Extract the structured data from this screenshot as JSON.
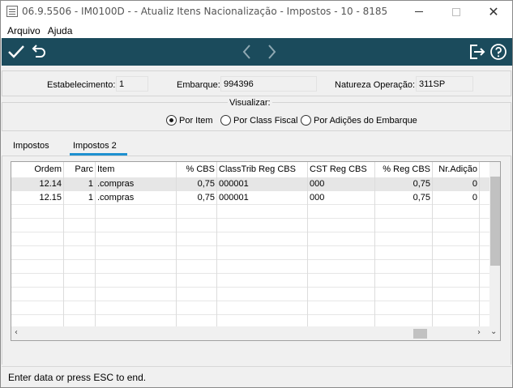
{
  "window": {
    "title": "06.9.5506 - IM0100D -  - Atualiz Itens Nacionalização - Impostos - 10 - 8185",
    "minimize_icon": "minimize-icon",
    "maximize_icon": "maximize-icon",
    "close_icon": "close-icon",
    "close_glyph": "✕"
  },
  "menu": {
    "items": [
      "Arquivo",
      "Ajuda"
    ]
  },
  "toolbar": {
    "icons": [
      "check-icon",
      "undo-icon",
      "chevron-left-icon",
      "chevron-right-icon",
      "exit-icon",
      "help-icon"
    ],
    "background": "#1b4b5c"
  },
  "header": {
    "estabelecimento_label": "Estabelecimento:",
    "estabelecimento_value": "1",
    "embarque_label": "Embarque:",
    "embarque_value": "994396",
    "natureza_label": "Natureza Operação:",
    "natureza_value": "311SP"
  },
  "visualizar": {
    "title": "Visualizar:",
    "options": [
      {
        "label": "Por Item",
        "checked": true
      },
      {
        "label": "Por Class Fiscal",
        "checked": false
      },
      {
        "label": "Por Adições do Embarque",
        "checked": false
      }
    ]
  },
  "tabs": [
    {
      "label": "Impostos",
      "active": false
    },
    {
      "label": "Impostos 2",
      "active": true
    }
  ],
  "grid": {
    "columns": [
      "Ordem",
      "Parc",
      "Item",
      "% CBS",
      "ClassTrib Reg CBS",
      "CST Reg CBS",
      "% Reg CBS",
      "Nr.Adição"
    ],
    "rows": [
      [
        "12.14",
        "1",
        ".compras",
        "0,75",
        "000001",
        "000",
        "0,75",
        "0"
      ],
      [
        "12.15",
        "1",
        ".compras",
        "0,75",
        "000001",
        "000",
        "0,75",
        "0"
      ]
    ],
    "selected_row": 0
  },
  "status": {
    "text": "Enter data or press ESC to end."
  },
  "colors": {
    "accent": "#1e90d0",
    "selected_row": "#e6e6e6"
  }
}
